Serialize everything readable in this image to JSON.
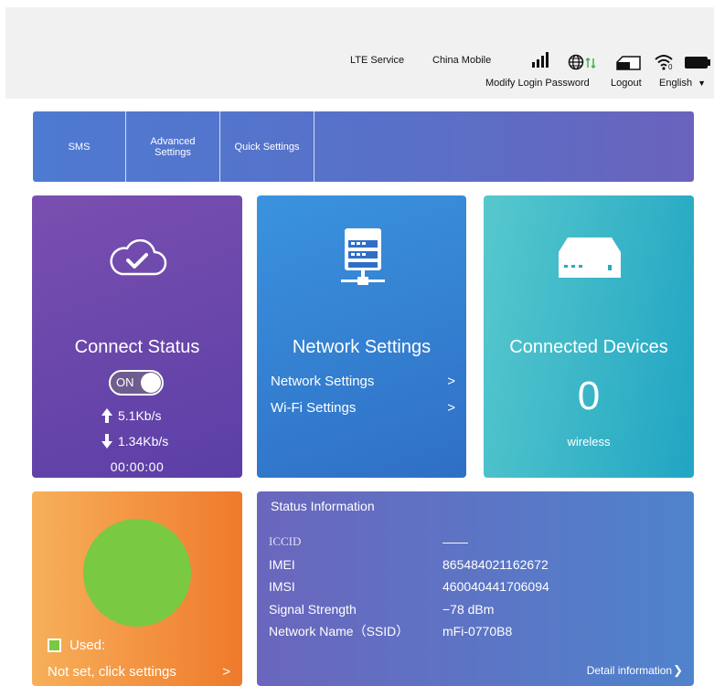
{
  "header": {
    "lte_service": "LTE Service",
    "carrier": "China Mobile",
    "wifi_clients": "0",
    "modify_password": "Modify Login Password",
    "logout": "Logout",
    "language": "English"
  },
  "nav": {
    "items": [
      {
        "label": "SMS"
      },
      {
        "label": "Advanced\nSettings"
      },
      {
        "label": "Quick Settings"
      }
    ]
  },
  "connect": {
    "title": "Connect Status",
    "toggle_label": "ON",
    "upload": "5.1Kb/s",
    "download": "1.34Kb/s",
    "duration": "00:00:00"
  },
  "network": {
    "title": "Network Settings",
    "links": [
      {
        "label": "Network Settings"
      },
      {
        "label": "Wi-Fi Settings"
      }
    ],
    "chevron": ">"
  },
  "devices": {
    "title": "Connected Devices",
    "count": "0",
    "type": "wireless"
  },
  "usage": {
    "used_label": "Used:",
    "not_set": "Not set, click settings",
    "chevron": ">"
  },
  "status": {
    "title": "Status Information",
    "rows": [
      {
        "key": "ICCID",
        "value": "——"
      },
      {
        "key": "IMEI",
        "value": "865484021162672"
      },
      {
        "key": "IMSI",
        "value": "460040441706094"
      },
      {
        "key": "Signal Strength",
        "value": "−78  dBm"
      },
      {
        "key": "Network Name（SSID）",
        "value": "mFi-0770B8"
      }
    ],
    "detail": "Detail information",
    "detail_chevron": "❯"
  },
  "colors": {
    "connect_card": "#6a47ac",
    "network_card": "#3482d2",
    "devices_card": "#3bb7c8",
    "usage_card": "#f3953f",
    "status_card": "#5f75c4",
    "usage_circle": "#7ac943"
  }
}
